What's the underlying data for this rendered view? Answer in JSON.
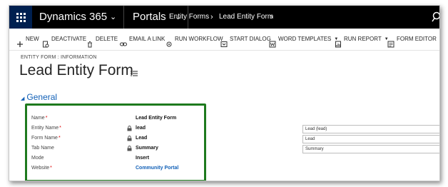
{
  "topnav": {
    "app_name": "Dynamics 365",
    "area": "Portals",
    "breadcrumb": [
      "Entity Forms",
      "Lead Entity Form"
    ]
  },
  "commands": [
    {
      "label": "NEW",
      "icon": "plus-icon"
    },
    {
      "label": "DEACTIVATE",
      "icon": "deactivate-icon"
    },
    {
      "label": "DELETE",
      "icon": "trash-icon"
    },
    {
      "label": "EMAIL A LINK",
      "icon": "link-icon"
    },
    {
      "label": "RUN WORKFLOW",
      "icon": "workflow-icon"
    },
    {
      "label": "START DIALOG",
      "icon": "dialog-icon"
    },
    {
      "label": "WORD TEMPLATES",
      "icon": "word-icon"
    },
    {
      "label": "RUN REPORT",
      "icon": "report-icon"
    },
    {
      "label": "FORM EDITOR",
      "icon": "form-editor-icon"
    }
  ],
  "header": {
    "entity_label": "ENTITY FORM : INFORMATION",
    "title": "Lead Entity Form"
  },
  "section": {
    "title": "General"
  },
  "fields": [
    {
      "label": "Name",
      "required": "*",
      "value": "Lead Entity Form",
      "locked": false
    },
    {
      "label": "Entity Name",
      "required": "*",
      "value": "lead",
      "locked": true
    },
    {
      "label": "Form Name",
      "required": "*",
      "value": "Lead",
      "locked": true
    },
    {
      "label": "Tab Name",
      "required": "",
      "value": "Summary",
      "locked": true
    },
    {
      "label": "Mode",
      "required": "",
      "value": "Insert",
      "locked": false
    },
    {
      "label": "Website",
      "required": "*",
      "value": "Community Portal",
      "locked": false
    }
  ],
  "right_fields": [
    "Lead (lead)",
    "Lead",
    "Summary"
  ],
  "colors": {
    "nav_bg": "#000000",
    "waffle_bg": "#002050",
    "accent": "#1160b7",
    "highlight": "#1e7a1e"
  }
}
